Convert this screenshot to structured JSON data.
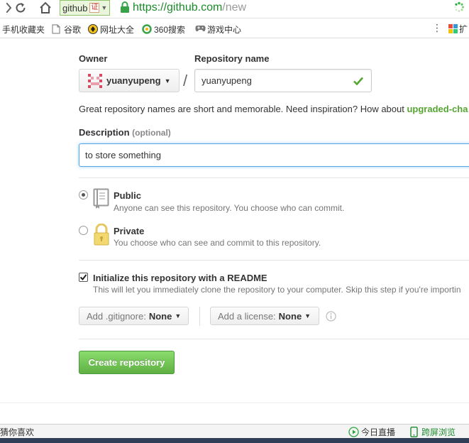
{
  "browser": {
    "site_badge": "github",
    "cert_badge": "证",
    "url_host": "https://github.com",
    "url_path": "/new",
    "bookmarks": [
      {
        "label": "手机收藏夹",
        "icon": "none"
      },
      {
        "label": "谷歌",
        "icon": "page-icon"
      },
      {
        "label": "网址大全",
        "icon": "nav-icon"
      },
      {
        "label": "360搜索",
        "icon": "search-360-icon"
      },
      {
        "label": "游戏中心",
        "icon": "gamepad-icon"
      }
    ],
    "more_glyph": "⋮",
    "ext_label": "扩"
  },
  "form": {
    "owner_label": "Owner",
    "owner_name": "yuanyupeng",
    "separator": "/",
    "repo_label": "Repository name",
    "repo_value": "yuanyupeng",
    "hint_text": "Great repository names are short and memorable. Need inspiration? How about ",
    "hint_suggestion": "upgraded-cha",
    "description_label": "Description",
    "description_optional": "(optional)",
    "description_value": "to store something",
    "visibility": [
      {
        "title": "Public",
        "desc": "Anyone can see this repository. You choose who can commit.",
        "selected": true
      },
      {
        "title": "Private",
        "desc": "You choose who can see and commit to this repository.",
        "selected": false
      }
    ],
    "init_title": "Initialize this repository with a README",
    "init_desc": "This will let you immediately clone the repository to your computer. Skip this step if you're importin",
    "init_checked": true,
    "gitignore_label": "Add .gitignore:",
    "gitignore_value": "None",
    "license_label": "Add a license:",
    "license_value": "None",
    "create_button": "Create repository"
  },
  "statusbar": {
    "left_text": "猜你喜欢",
    "live_text": "今日直播",
    "sync_text": "跨屏浏览"
  },
  "colors": {
    "accent_green": "#60b044",
    "url_green": "#1b8a28",
    "focus_blue": "#51a7e8"
  }
}
